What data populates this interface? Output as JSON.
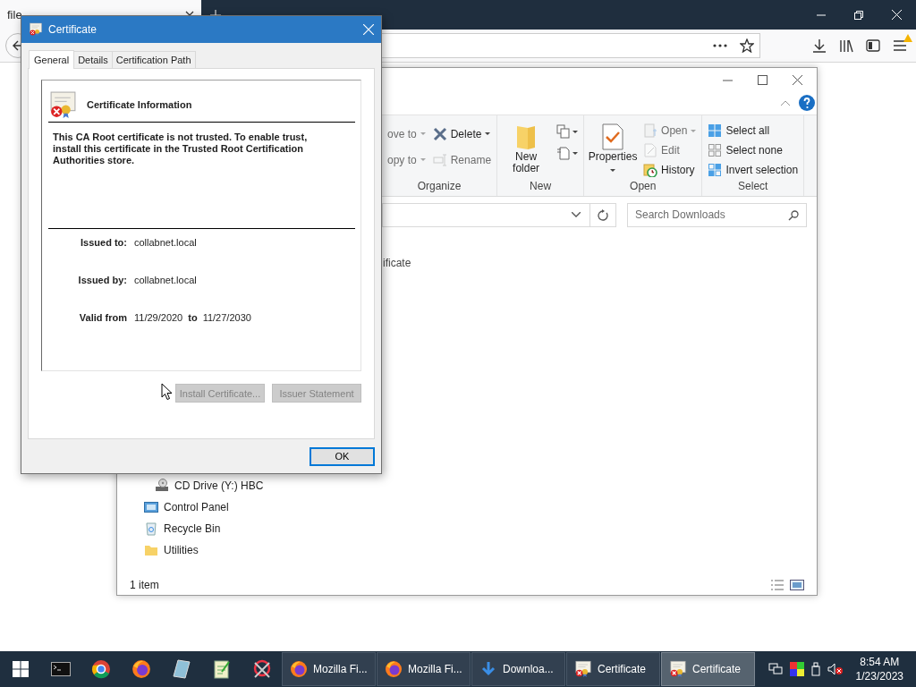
{
  "browser": {
    "tab": {
      "label": "file"
    }
  },
  "explorer": {
    "ribbon": {
      "groups": [
        {
          "label": "Organize",
          "columns": [
            [
              {
                "label": "ove to",
                "kind": "small",
                "dropdown": true,
                "disabled": true
              },
              {
                "label": "opy to",
                "kind": "small",
                "dropdown": true,
                "disabled": true
              }
            ],
            [
              {
                "label": "Delete",
                "kind": "small",
                "dropdown": true,
                "disabled": false
              },
              {
                "label": "Rename",
                "kind": "small",
                "dropdown": false,
                "disabled": true
              }
            ]
          ]
        },
        {
          "label": "New",
          "columns": [
            [
              {
                "label": "New folder",
                "kind": "large",
                "dropdown": false,
                "disabled": false
              }
            ],
            [
              {
                "kind": "icon",
                "dropdown": true,
                "disabled": false
              },
              {
                "kind": "icon",
                "dropdown": true,
                "disabled": false
              }
            ]
          ]
        },
        {
          "label": "Open",
          "columns": [
            [
              {
                "label": "Properties",
                "kind": "large",
                "dropdown": true,
                "disabled": false
              }
            ],
            [
              {
                "label": "Open",
                "kind": "small",
                "dropdown": true,
                "disabled": true
              },
              {
                "label": "Edit",
                "kind": "small",
                "dropdown": false,
                "disabled": true
              },
              {
                "label": "History",
                "kind": "small",
                "dropdown": false,
                "disabled": false
              }
            ]
          ]
        },
        {
          "label": "Select",
          "columns": [
            [
              {
                "label": "Select all",
                "kind": "small",
                "dropdown": false,
                "disabled": false
              },
              {
                "label": "Select none",
                "kind": "small",
                "dropdown": false,
                "disabled": false
              },
              {
                "label": "Invert selection",
                "kind": "small",
                "dropdown": false,
                "disabled": false
              }
            ]
          ]
        }
      ]
    },
    "search": {
      "placeholder": "Search Downloads"
    },
    "file": {
      "name": "ificate"
    },
    "nav": [
      {
        "label": "CD Drive (Y:) HBC",
        "kind": "drive"
      },
      {
        "label": "Control Panel",
        "kind": "control_panel"
      },
      {
        "label": "Recycle Bin",
        "kind": "recycle_bin"
      },
      {
        "label": "Utilities",
        "kind": "folder"
      }
    ],
    "status": "1 item"
  },
  "dialog": {
    "title": "Certificate",
    "tabs": [
      {
        "label": "General",
        "selected": true
      },
      {
        "label": "Details",
        "selected": false
      },
      {
        "label": "Certification Path",
        "selected": false
      }
    ],
    "heading": "Certificate Information",
    "message": "This CA Root certificate is not trusted. To enable trust, install this certificate in the Trusted Root Certification Authorities store.",
    "fields": [
      {
        "label": "Issued to:",
        "value": "collabnet.local"
      },
      {
        "label": "Issued by:",
        "value": "collabnet.local"
      }
    ],
    "validity": {
      "label": "Valid from",
      "from": "11/29/2020",
      "separator": "to",
      "to": "11/27/2030"
    },
    "buttons": [
      {
        "label": "Install Certificate...",
        "disabled": true
      },
      {
        "label": "Issuer Statement",
        "disabled": true
      }
    ],
    "ok": {
      "label": "OK"
    }
  },
  "taskbar": {
    "tasks": [
      {
        "label": "Mozilla Fi...",
        "kind": "firefox",
        "selected": false
      },
      {
        "label": "Mozilla Fi...",
        "kind": "firefox",
        "selected": false
      },
      {
        "label": "Downloa...",
        "kind": "download",
        "selected": false
      },
      {
        "label": "Certificate",
        "kind": "certificate",
        "selected": false
      },
      {
        "label": "Certificate",
        "kind": "certificate",
        "selected": true
      }
    ],
    "clock": {
      "time": "8:54 AM",
      "date": "1/23/2023"
    }
  }
}
